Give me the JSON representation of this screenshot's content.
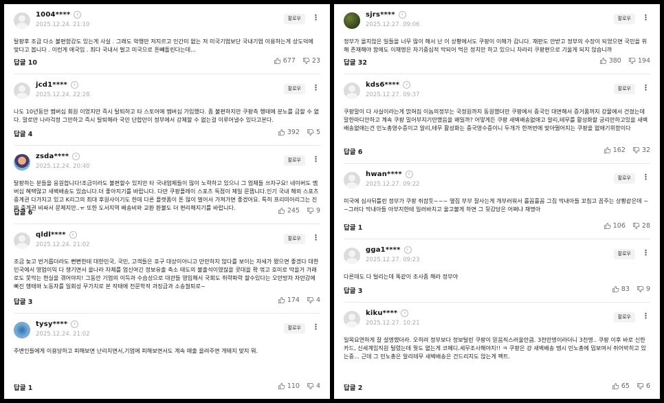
{
  "follow_label": "팔로우",
  "left": [
    {
      "user": "1004****",
      "date": "2025.12.24. 21:10",
      "text": "탈팡후 조금 다소 불편함감도 있는게 사실 . 그래도 악행만 저지르고 인간미 없는 저 미국기업보단 국내기업 이용하는게 상도덕에 맞다고 봅니다 . 이런게 애국임 . 최다 국내서 벌고 미국으로 돈빼돌린다는데...",
      "reply": "답글 10",
      "likes": "677",
      "dislikes": "23",
      "avatar": "default"
    },
    {
      "user": "jcd1****",
      "date": "2025.12.24. 22:28",
      "text": "나도 10년동안 멤버십 회원 이었지만 즉시 탈퇴하고 타 스토어에 멤버십 가입했다. 좀 불편하지만 쿠팡측 행태에 분노를 금할 수 없다. 말로만 나라걱정 그만하고 즉시 탈퇴해라 국민 단합만이 정부에서 강제할 수 없는걸 이루어낼수 있다고본다.",
      "reply": "답글 4",
      "likes": "392",
      "dislikes": "5",
      "avatar": "default"
    },
    {
      "user": "zsda****",
      "date": "2025.12.24. 20:40",
      "text": "탈팡하는 분들을 응원합니다!조금이라도 불편할수 있지만 타 국내업체들이 많이 노력하고 있으니 그 업체들 쓰자구요! 네이버도 멤버십 혜택많고 새벽배송도 있습니다.더 좋아지기를 바랍니다. 다만 쿠팡플레이 스포츠 독점이 제일 문젭니다.인기 국내 해외 스포츠 중계권 다가지고 있고 K리그의 최대 후원사이기도 한데 다른 플랫폼이 돈 많이 벌어서 가져가면 좋겠어요. 특히 프리미어리그는 진짜 중계권 비싸서 문제지만..ㅠ 또한 도서지역 배송비와 교환 환불도 더 편리해지기를 바랍니다.",
      "reply": "답글 6",
      "likes": "245",
      "dislikes": "9",
      "avatar": "anime"
    },
    {
      "user": "qldl****",
      "date": "2025.12.24. 21:02",
      "text": "조금 늦고 번거롭더라도 뻔뻔한테 대한민국, 국민, 고객들은 호구 대상이아니고 만만하지 않다를 보이는 자세가 됐으면 좋겠다 대한민국에서 영업이익 다 챙기면서 올나라 자체를 업신여긴 정보유출 축소 태도의 불출석이였잖을 콧대을 확 꺾고 호미로 막을거 가래로도 못막는 현실을 겪어야지! 그동안 기업의 이득과 수습성으로 대관들 영입해서 국회도 취락파락 할수있다는 오만방자 자만감에 빠진 행태와 노동자를 일회성 무가치로 본 작태에 천문학적 과징금과 소송철퇴로~",
      "reply": "답글 3",
      "likes": "174",
      "dislikes": "4",
      "avatar": "default"
    },
    {
      "user": "tysy****",
      "date": "2025.12.24. 21:02",
      "text": "주변인들에게 이용당하고 피해보면 난리치면서,기업에 피해보면서도 계속 매출 올려주면 개돼지 맞지 뭐.",
      "reply": "답글 1",
      "likes": "110",
      "dislikes": "4",
      "avatar": "sky"
    }
  ],
  "right": [
    {
      "user": "sjrs****",
      "date": "2025.12.27. 09:06",
      "text": "정부가 올지않은 일들을 너무 많이 해서 난 이 상황에서도 쿠팡이 이해가 갑니다. 재판도 안받고 정부의 수장이 되었으면 국민을 위해 존재해야 함에도 이재명은 자기중심적 막되어 먹은 정치만 하고 있으니 차라리 쿠팡편으로 기울게 되지 않습니까",
      "reply": "답글 32",
      "likes": "380",
      "dislikes": "194",
      "avatar": "forest"
    },
    {
      "user": "kds6****",
      "date": "2025.12.27. 09:37",
      "text": "쿠팡말이 다 사실이라는게 밝혀짐 이놈의정부는 국정원까지 동원했더만 쿠팡에서 중국인 대면해서 증거품까지 강물에서 건졌는데 말한마디안하고 계속 쿠팡 밀어부치기만했음을 왜일까? 어떻게든 쿠팡 새벽배송없애고 알리,테무를 활성화할 궁리만하고있을 새벽배송없애는건 민노총영수증이고 알리,테무 활성화는 중국영수증이니 두개가 한꺼번에 맞아떨어지는 쿠팡을 없애기위함이다",
      "reply": "답글 6",
      "likes": "162",
      "dislikes": "32",
      "avatar": "default"
    },
    {
      "user": "hwan****",
      "date": "2025.12.27. 09:22",
      "text": "미국에 심사뒤틀린 정부가 쿠팡 쥐잡듯~~~ 옆집 부부 잘사는게 개부러워서 흘꼼흘꼼 그집 막내아들 꼬침고 꼽주는 상황같은데 ~~그러다 막내아들 아부지한테 일러바치고 울고불게 하면 그 뒷감당은 어쩌냐 재명아",
      "reply": "답글 1",
      "likes": "106",
      "dislikes": "28",
      "avatar": "default"
    },
    {
      "user": "gga1****",
      "date": "2025.12.27. 09:23",
      "text": "다른데도 다 털리는데 똑같이 조사좀 해라 정부야",
      "reply": "답글 3",
      "likes": "83",
      "dislikes": "9",
      "avatar": "default"
    },
    {
      "user": "kiku****",
      "date": "2025.12.27. 10:21",
      "text": "일목요연하게 잘 설명했더라. 오히려 정부보다 정보털린 쿠팡이 믿음직스러울만큼. 3천만명이라더니 3천명.. 쿠팡 이후 바로 신한카드, 신세계임직원 털렸는데 뭣도 없는게 코메디.세무조사해야지!! ㅋ 쿠팡은 걍 새벽배송 땜시 민노총에 밉보여서 쥐어박히고 있는중... 근데 그 민노총은 알리테무 새벽배송은 건드리지도 않는게 팩트.",
      "reply": "답글 2",
      "likes": "65",
      "dislikes": "6",
      "avatar": "default"
    }
  ]
}
